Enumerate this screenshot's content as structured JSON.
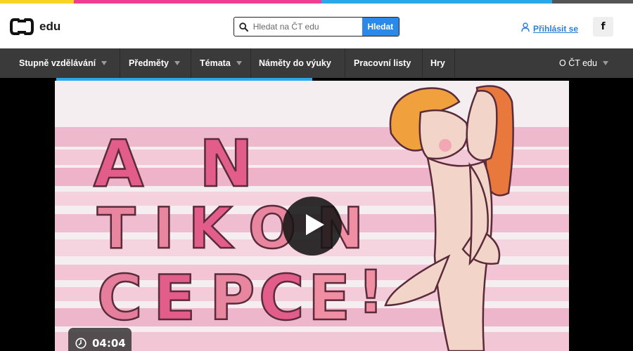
{
  "colors": {
    "stripe": [
      "#f6d528",
      "#ee3f95",
      "#2ba8e8",
      "#555555"
    ],
    "accent": "#2b8ae8",
    "nav_bg": "#3a3a3a",
    "nav_underline": "#2ba8e8"
  },
  "header": {
    "logo_icon": "ct-logo-icon",
    "logo_text": "edu",
    "search": {
      "placeholder": "Hledat na ČT edu",
      "button_label": "Hledat",
      "icon": "search-icon"
    },
    "login": {
      "icon": "user-icon",
      "label": "Přihlásit se"
    },
    "facebook": {
      "icon": "facebook-icon",
      "label": "f"
    }
  },
  "nav": {
    "items": [
      {
        "label": "Stupně vzdělávání",
        "has_dropdown": true
      },
      {
        "label": "Předměty",
        "has_dropdown": true
      },
      {
        "label": "Témata",
        "has_dropdown": true
      },
      {
        "label": "Náměty do výuky",
        "has_dropdown": false
      },
      {
        "label": "Pracovní listy",
        "has_dropdown": false
      },
      {
        "label": "Hry",
        "has_dropdown": false
      }
    ],
    "about": {
      "label": "O ČT edu",
      "has_dropdown": true
    }
  },
  "video": {
    "play_icon": "play-icon",
    "duration": "04:04",
    "duration_icon": "clock-icon",
    "title_art": "ANTIKONCEPCE!"
  }
}
